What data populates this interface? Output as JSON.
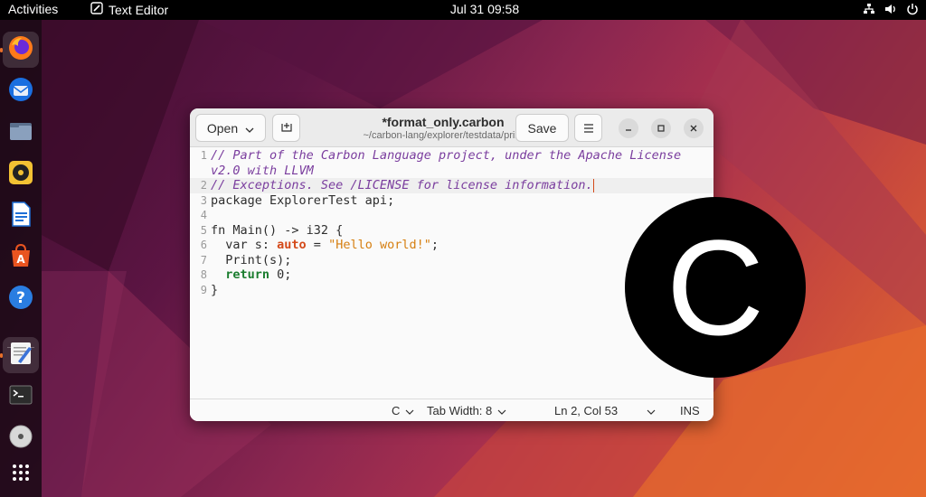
{
  "topbar": {
    "activities": "Activities",
    "app_name": "Text Editor",
    "clock": "Jul 31  09:58",
    "tray_icons": [
      "network-icon",
      "volume-icon",
      "power-icon"
    ]
  },
  "dock": {
    "items": [
      "firefox",
      "thunderbird",
      "files",
      "rhythmbox",
      "libreoffice-writer",
      "app-center",
      "help",
      "text-editor",
      "terminal",
      "optical-drive",
      "show-apps"
    ],
    "active": "text-editor"
  },
  "window": {
    "open_label": "Open",
    "title": "*format_only.carbon",
    "subtitle": "~/carbon-lang/explorer/testdata/print",
    "save_label": "Save"
  },
  "editor": {
    "lines": [
      {
        "num": "1",
        "text": "// Part of the Carbon Language project, under the Apache License"
      },
      {
        "num": "",
        "text": "v2.0 with LLVM"
      },
      {
        "num": "2",
        "text": "// Exceptions. See /LICENSE for license information."
      },
      {
        "num": "3",
        "text": "package ExplorerTest api;"
      },
      {
        "num": "4",
        "text": ""
      },
      {
        "num": "5",
        "text": "fn Main() -> i32 {"
      },
      {
        "num": "6",
        "text": "  var s: auto = \"Hello world!\";"
      },
      {
        "num": "7",
        "text": "  Print(s);"
      },
      {
        "num": "8",
        "text": "  return 0;"
      },
      {
        "num": "9",
        "text": "}"
      }
    ],
    "line6": {
      "pre": "  var s: ",
      "type": "auto",
      "mid": " = ",
      "string": "\"Hello world!\"",
      "post": ";"
    },
    "line8": {
      "pre": "  ",
      "keyword": "return",
      "post": " 0;"
    }
  },
  "statusbar": {
    "language": "C",
    "tab_width": "Tab Width: 8",
    "position": "Ln 2, Col 53",
    "mode": "INS"
  },
  "logo": {
    "letter": "C"
  },
  "colors": {
    "accent": "#e8702a",
    "comment": "#7a3d9e",
    "keyword": "#1a7d2e",
    "string": "#d67f10"
  }
}
